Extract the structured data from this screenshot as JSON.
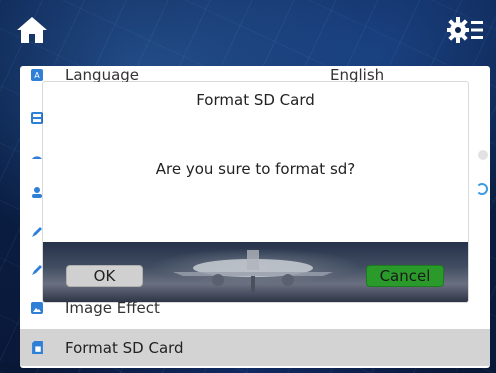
{
  "colors": {
    "background": "#0a1f45",
    "cancel_button": "#2a9b2a",
    "ok_button": "#d0d0d0",
    "selected_row": "#d3d3d3",
    "row_icon": "#2f7fd6"
  },
  "header": {
    "home_icon": "home-icon",
    "settings_icon": "settings-list-icon"
  },
  "settings_list": {
    "language": {
      "label": "Language",
      "value": "English",
      "icon": "language-icon"
    },
    "image_effect": {
      "label": "Image Effect",
      "icon": "image-icon"
    },
    "format_sd": {
      "label": "Format SD Card",
      "icon": "sd-card-icon"
    }
  },
  "dialog": {
    "title": "Format SD Card",
    "message": "Are you sure to format sd?",
    "ok_label": "OK",
    "cancel_label": "Cancel"
  }
}
